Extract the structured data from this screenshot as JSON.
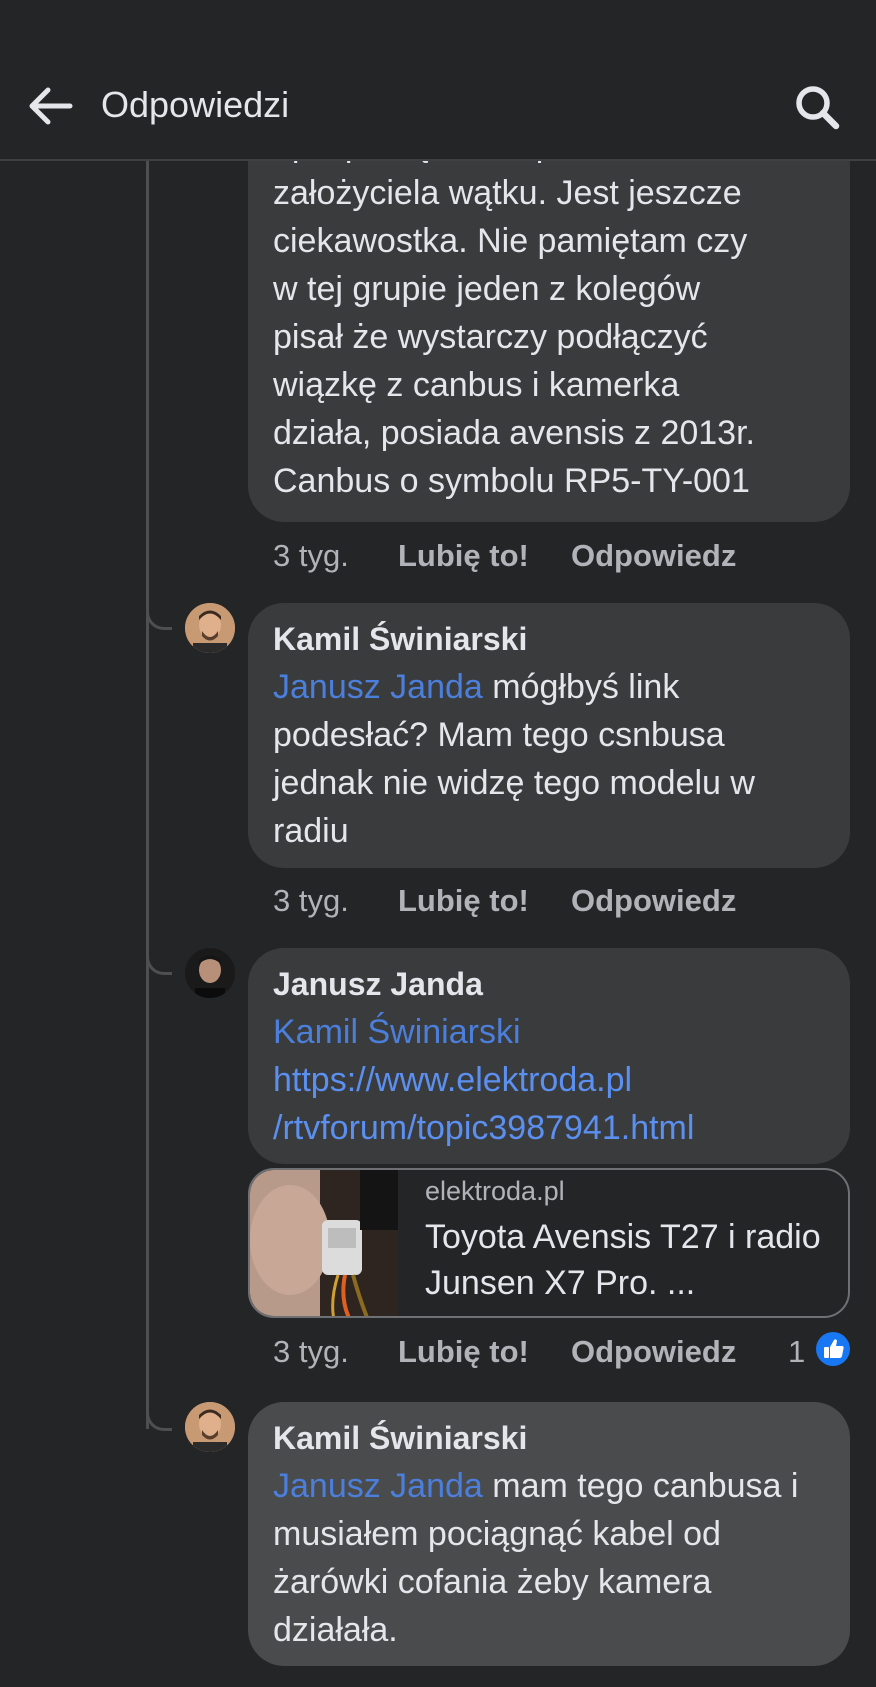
{
  "header": {
    "title": "Odpowiedzi",
    "back_icon": "arrow-left-icon",
    "search_icon": "search-icon"
  },
  "colors": {
    "background": "#242526",
    "bubble": "#3a3b3c",
    "mention": "#4b7fdb",
    "like_blue": "#1877f2"
  },
  "comments": [
    {
      "text": "opis podłączenia przez założyciela wątku. Jest jeszcze ciekawostka. Nie pamiętam czy w tej grupie jeden z kolegów pisał że wystarczy podłączyć wiązkę z canbus i kamerka działa, posiada avensis z 2013r. Canbus o symbolu RP5-TY-001",
      "lines": [
        "opis podłączenia przez",
        "założyciela wątku. Jest jeszcze",
        "ciekawostka. Nie pamiętam czy",
        "w tej grupie jeden z kolegów",
        "pisał że wystarczy podłączyć",
        "wiązkę z canbus i kamerka",
        "działa, posiada avensis z 2013r.",
        "Canbus o symbolu RP5-TY-001"
      ],
      "time": "3 tyg.",
      "like_label": "Lubię to!",
      "reply_label": "Odpowiedz"
    },
    {
      "author": "Kamil Świniarski",
      "mention": "Janusz Janda",
      "text": " mógłbyś link podesłać? Mam tego csnbusa jednak nie widzę tego modelu  w radiu",
      "time": "3 tyg.",
      "like_label": "Lubię to!",
      "reply_label": "Odpowiedz"
    },
    {
      "author": "Janusz Janda",
      "mention": "Kamil Świniarski",
      "link_line1": "https://www.elektroda.pl",
      "link_line2": "/rtvforum/topic3987941.html",
      "preview_domain": "elektroda.pl",
      "preview_title": "Toyota Avensis T27 i radio Junsen X7 Pro. ...",
      "time": "3 tyg.",
      "like_label": "Lubię to!",
      "reply_label": "Odpowiedz",
      "likes": "1"
    },
    {
      "author": "Kamil Świniarski",
      "mention": "Janusz Janda",
      "text": " mam tego canbusa i musiałem pociągnąć kabel od żarówki cofania żeby kamera działała."
    }
  ]
}
